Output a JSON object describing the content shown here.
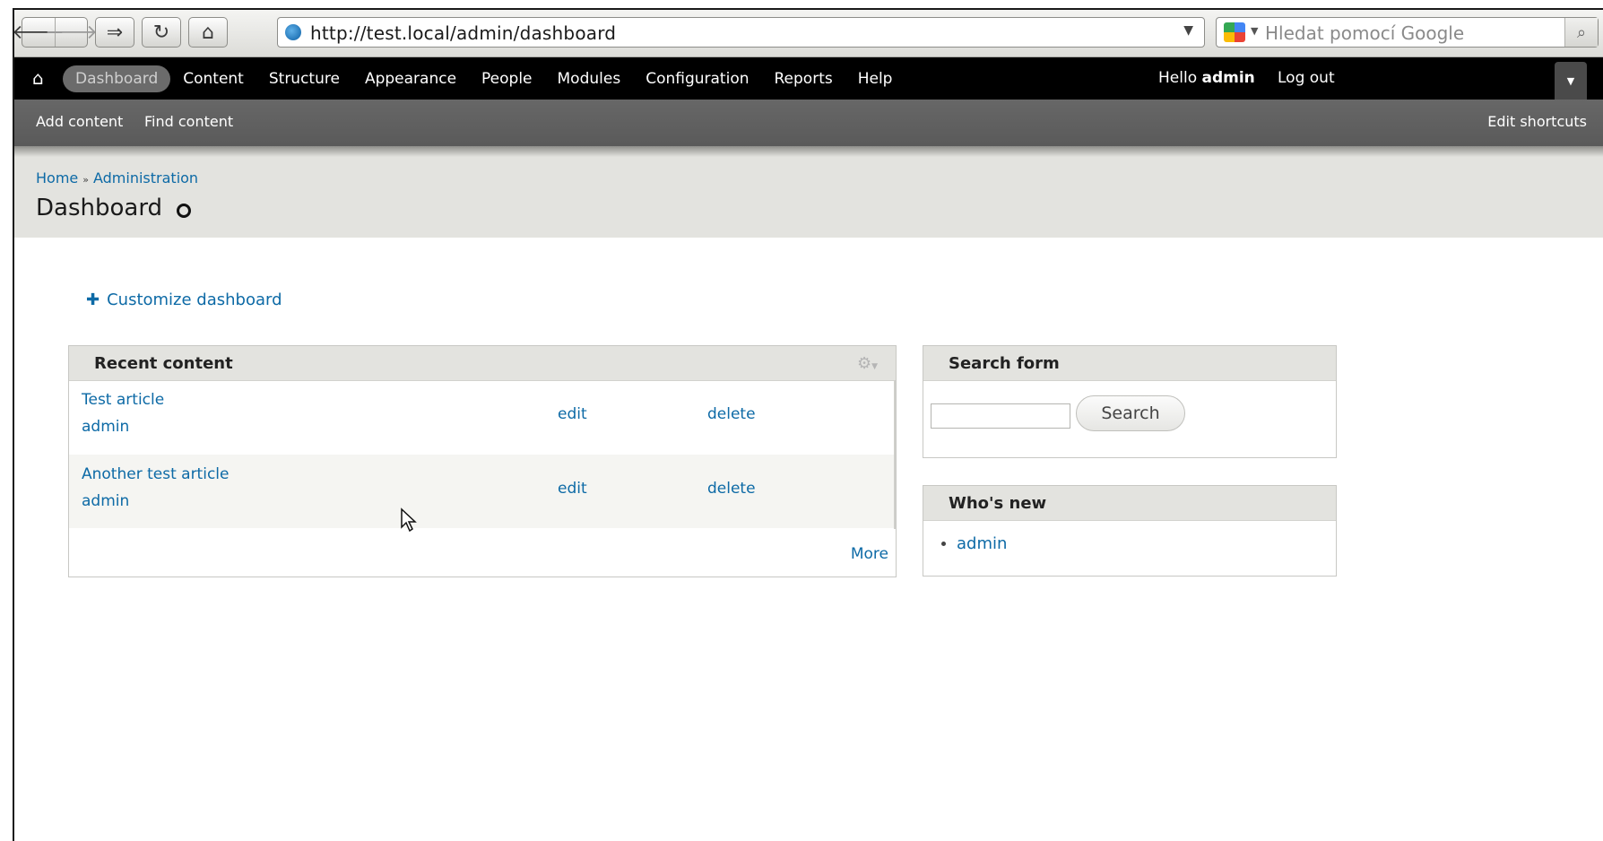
{
  "browser": {
    "url": "http://test.local/admin/dashboard",
    "search_placeholder": "Hledat pomocí Google"
  },
  "toolbar": {
    "menu": [
      "Dashboard",
      "Content",
      "Structure",
      "Appearance",
      "People",
      "Modules",
      "Configuration",
      "Reports",
      "Help"
    ],
    "hello_prefix": "Hello",
    "hello_user": "admin",
    "logout": "Log out"
  },
  "shortcuts": {
    "add_content": "Add content",
    "find_content": "Find content",
    "edit_shortcuts": "Edit shortcuts"
  },
  "page": {
    "breadcrumb": [
      "Home",
      "Administration"
    ],
    "breadcrumb_sep": "»",
    "title": "Dashboard"
  },
  "customize": "Customize dashboard",
  "recent_content": {
    "title": "Recent content",
    "rows": [
      {
        "title": "Test article",
        "author": "admin",
        "edit": "edit",
        "delete": "delete"
      },
      {
        "title": "Another test article",
        "author": "admin",
        "edit": "edit",
        "delete": "delete"
      }
    ],
    "more": "More"
  },
  "search_form": {
    "title": "Search form",
    "input_value": "",
    "button": "Search"
  },
  "whos_new": {
    "title": "Who's new",
    "items": [
      "admin"
    ]
  },
  "icons": {
    "back": "back-arrow-icon",
    "forward": "forward-arrow-icon",
    "reload": "reload-icon",
    "home": "home-icon",
    "gear": "gear-icon"
  },
  "colors": {
    "link": "#0d6aa6",
    "toolbar_bg": "#000000",
    "shortcut_bg": "#5f5f5f",
    "header_bg": "#e3e3df"
  }
}
